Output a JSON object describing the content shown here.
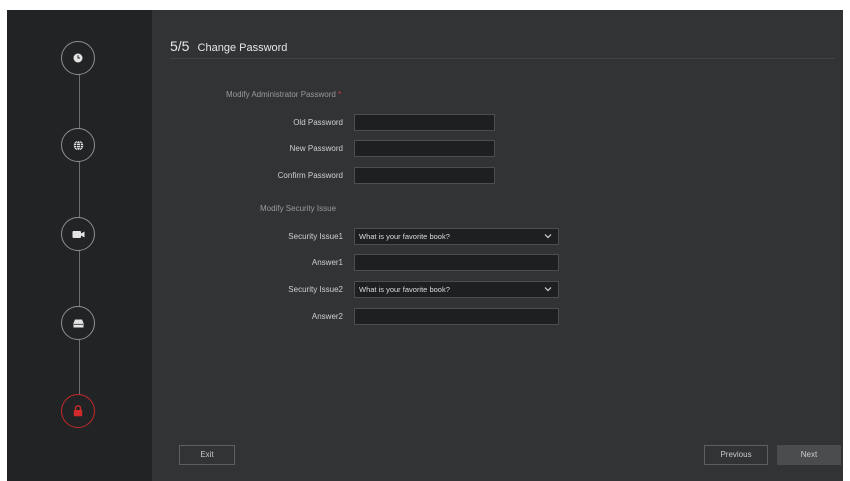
{
  "header": {
    "step": "5/5",
    "title": "Change Password"
  },
  "admin_section": {
    "label": "Modify Administrator Password",
    "required_mark": "*"
  },
  "fields": {
    "old_password": {
      "label": "Old Password",
      "value": ""
    },
    "new_password": {
      "label": "New Password",
      "value": ""
    },
    "confirm_password": {
      "label": "Confirm Password",
      "value": ""
    }
  },
  "security_section": {
    "label": "Modify Security Issue"
  },
  "security": {
    "issue1": {
      "label": "Security Issue1",
      "value": "What is your favorite book?"
    },
    "answer1": {
      "label": "Answer1",
      "value": ""
    },
    "issue2": {
      "label": "Security Issue2",
      "value": "What is your favorite book?"
    },
    "answer2": {
      "label": "Answer2",
      "value": ""
    }
  },
  "buttons": {
    "exit": "Exit",
    "previous": "Previous",
    "next": "Next"
  },
  "steps": [
    {
      "icon": "clock-icon",
      "active": false
    },
    {
      "icon": "globe-icon",
      "active": false
    },
    {
      "icon": "camera-icon",
      "active": false
    },
    {
      "icon": "hard-disk-icon",
      "active": false
    },
    {
      "icon": "lock-icon",
      "active": true
    }
  ],
  "colors": {
    "accent": "#c42a2a",
    "sidebar": "#222325",
    "panel": "#323335"
  }
}
